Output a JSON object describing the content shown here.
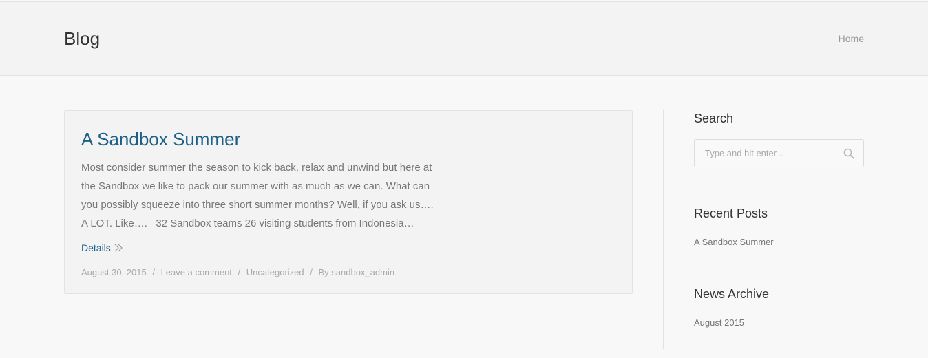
{
  "header": {
    "title": "Blog",
    "breadcrumb_home": "Home"
  },
  "post": {
    "title": "A Sandbox Summer",
    "excerpt_lines": [
      "Most consider summer the season to kick back, relax and unwind but here at",
      "the Sandbox we like to pack our summer with as much as we can. What can",
      "you possibly squeeze into three short summer months? Well, if you ask us….",
      "A LOT. Like….   32 Sandbox teams 26 visiting students from Indonesia…"
    ],
    "details_label": "Details",
    "meta": {
      "date": "August 30, 2015",
      "comments": "Leave a comment",
      "category": "Uncategorized",
      "author": "By sandbox_admin",
      "separator": "/"
    }
  },
  "sidebar": {
    "search": {
      "title": "Search",
      "placeholder": "Type and hit enter ..."
    },
    "recent_posts": {
      "title": "Recent Posts",
      "items": [
        "A Sandbox Summer"
      ]
    },
    "archive": {
      "title": "News Archive",
      "items": [
        "August 2015"
      ]
    }
  },
  "colors": {
    "accent": "#1d6085",
    "background": "#f8f8f8",
    "header_bg": "#f3f3f3"
  }
}
